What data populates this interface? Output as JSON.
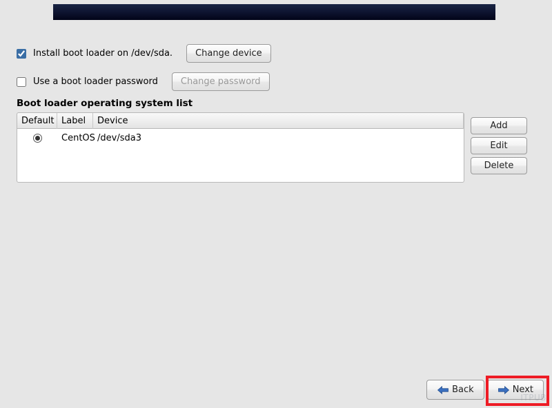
{
  "install_bootloader": {
    "checked": true,
    "label": "Install boot loader on /dev/sda.",
    "change_device": "Change device"
  },
  "use_password": {
    "checked": false,
    "label": "Use a boot loader password",
    "change_password": "Change password"
  },
  "list_title": "Boot loader operating system list",
  "columns": {
    "default": "Default",
    "label": "Label",
    "device": "Device"
  },
  "entries": [
    {
      "default": true,
      "label": "CentOS",
      "device": "/dev/sda3"
    }
  ],
  "side": {
    "add": "Add",
    "edit": "Edit",
    "delete": "Delete"
  },
  "nav": {
    "back": "Back",
    "next": "Next"
  },
  "watermark": "ITPUB"
}
